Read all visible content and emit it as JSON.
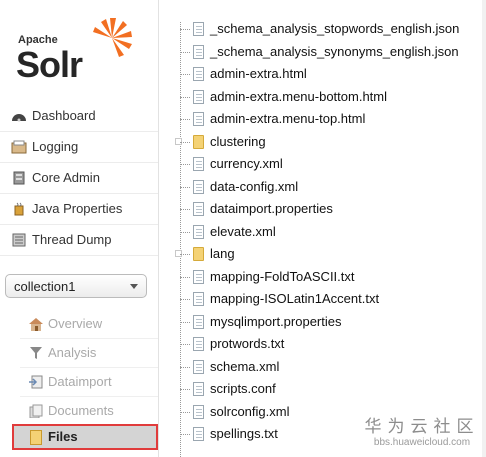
{
  "logo": {
    "apache": "Apache",
    "solr": "Solr"
  },
  "nav": [
    {
      "label": "Dashboard",
      "icon": "dashboard-icon"
    },
    {
      "label": "Logging",
      "icon": "logging-icon"
    },
    {
      "label": "Core Admin",
      "icon": "core-admin-icon"
    },
    {
      "label": "Java Properties",
      "icon": "java-properties-icon"
    },
    {
      "label": "Thread Dump",
      "icon": "thread-dump-icon"
    }
  ],
  "core_selector": {
    "value": "collection1"
  },
  "core_menu": [
    {
      "label": "Overview",
      "icon": "overview-icon"
    },
    {
      "label": "Analysis",
      "icon": "analysis-icon"
    },
    {
      "label": "Dataimport",
      "icon": "dataimport-icon"
    },
    {
      "label": "Documents",
      "icon": "documents-icon"
    },
    {
      "label": "Files",
      "icon": "folder-icon",
      "selected": true
    }
  ],
  "files": [
    {
      "name": "_schema_analysis_stopwords_english.json",
      "type": "file"
    },
    {
      "name": "_schema_analysis_synonyms_english.json",
      "type": "file"
    },
    {
      "name": "admin-extra.html",
      "type": "file"
    },
    {
      "name": "admin-extra.menu-bottom.html",
      "type": "file"
    },
    {
      "name": "admin-extra.menu-top.html",
      "type": "file"
    },
    {
      "name": "clustering",
      "type": "folder"
    },
    {
      "name": "currency.xml",
      "type": "file"
    },
    {
      "name": "data-config.xml",
      "type": "file"
    },
    {
      "name": "dataimport.properties",
      "type": "file"
    },
    {
      "name": "elevate.xml",
      "type": "file"
    },
    {
      "name": "lang",
      "type": "folder"
    },
    {
      "name": "mapping-FoldToASCII.txt",
      "type": "file"
    },
    {
      "name": "mapping-ISOLatin1Accent.txt",
      "type": "file"
    },
    {
      "name": "mysqlimport.properties",
      "type": "file"
    },
    {
      "name": "protwords.txt",
      "type": "file"
    },
    {
      "name": "schema.xml",
      "type": "file"
    },
    {
      "name": "scripts.conf",
      "type": "file"
    },
    {
      "name": "solrconfig.xml",
      "type": "file"
    },
    {
      "name": "spellings.txt",
      "type": "file"
    }
  ],
  "watermark": {
    "cn": "华为云社区",
    "url": "bbs.huaweicloud.com"
  },
  "colors": {
    "selected_border": "#e03b3b",
    "selected_bg": "#d4d4d4",
    "folder": "#f4d275",
    "logo_accent": "#f26f22"
  }
}
